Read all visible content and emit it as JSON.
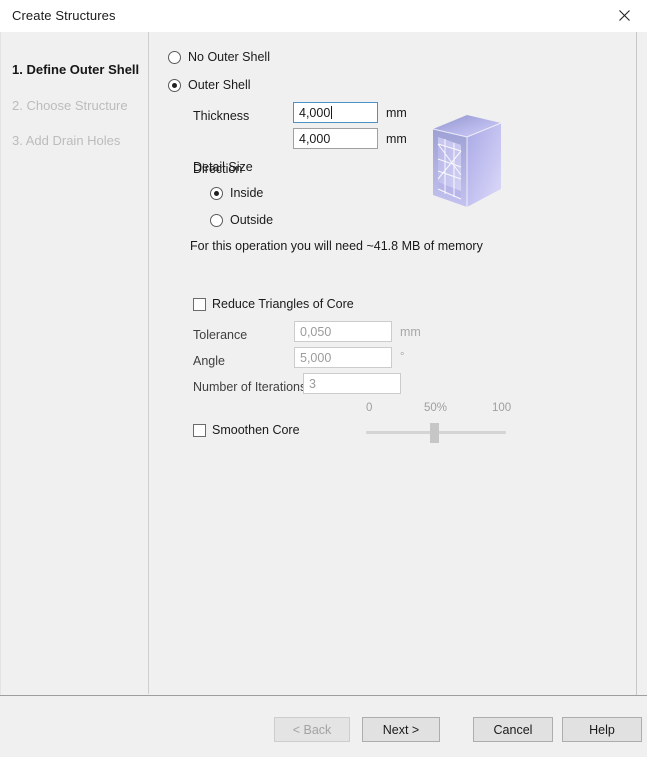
{
  "window": {
    "title": "Create Structures",
    "close_icon": "close-icon"
  },
  "steps": [
    {
      "label": "1. Define Outer Shell",
      "state": "active"
    },
    {
      "label": "2. Choose Structure",
      "state": "disabled"
    },
    {
      "label": "3. Add Drain Holes",
      "state": "disabled"
    }
  ],
  "shell": {
    "no_outer_shell_label": "No Outer Shell",
    "no_outer_shell_checked": false,
    "outer_shell_label": "Outer Shell",
    "outer_shell_checked": true,
    "thickness_label": "Thickness",
    "thickness_value": "4,000",
    "thickness_unit": "mm",
    "detail_size_label": "Detail Size",
    "detail_size_value": "4,000",
    "detail_size_unit": "mm",
    "direction_label": "Direction",
    "inside_label": "Inside",
    "inside_checked": true,
    "outside_label": "Outside",
    "outside_checked": false,
    "memory_note": "For this operation you will need ~41.8 MB of memory",
    "preview_icon": "hollow-cube-icon"
  },
  "reduce": {
    "checkbox_label": "Reduce Triangles of Core",
    "checked": false,
    "tolerance_label": "Tolerance",
    "tolerance_value": "0,050",
    "tolerance_unit": "mm",
    "angle_label": "Angle",
    "angle_value": "5,000",
    "angle_unit": "°",
    "iterations_label": "Number of Iterations",
    "iterations_value": "3"
  },
  "smoothen": {
    "checkbox_label": "Smoothen Core",
    "checked": false,
    "tick_min": "0",
    "tick_mid": "50%",
    "tick_max": "100",
    "value_percent": 50
  },
  "footer": {
    "back_label": "< Back",
    "back_disabled": true,
    "next_label": "Next >",
    "cancel_label": "Cancel",
    "help_label": "Help"
  },
  "colors": {
    "dialog_bg": "#f0f0f0",
    "titlebar_bg": "#ffffff",
    "focus_border": "#4a93c4",
    "preview_accent": "#b9b6ee"
  }
}
